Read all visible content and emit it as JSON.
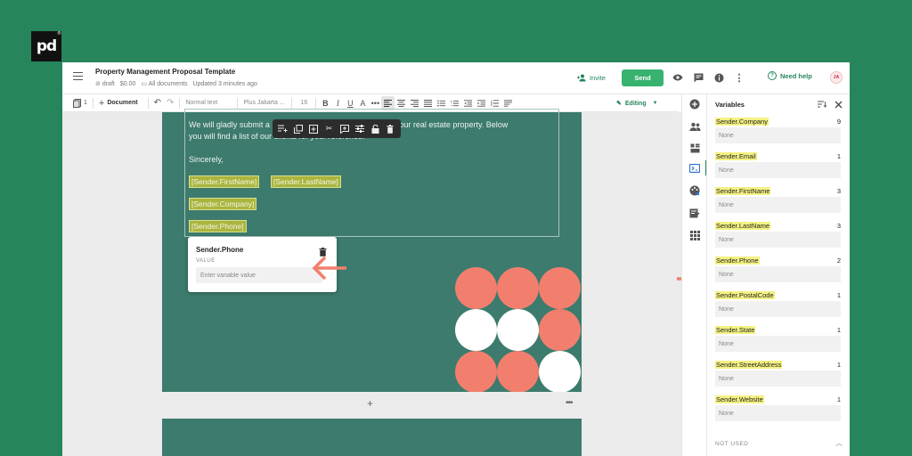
{
  "brand": {
    "logo_text": "pd",
    "logo_mark": "®"
  },
  "header": {
    "title": "Property Management Proposal Template",
    "status": "draft",
    "price": "$0.00",
    "folder": "All documents",
    "updated": "Updated 3 minutes ago",
    "invite_label": "Invite",
    "send_label": "Send",
    "help_label": "Need help",
    "avatar_initials": "JA"
  },
  "toolbar": {
    "page_count": "1",
    "document_label": "Document",
    "style_value": "Normal text",
    "font_value": "Plus Jakarta ...",
    "size_value": "16",
    "mode_label": "Editing"
  },
  "document": {
    "paragraph": "We will gladly submit a proposal for the management of your real estate property. Below you will find a list of our clients for your reference.",
    "paragraph_visible_start": "We will gladly submit a",
    "paragraph_visible_end": "ent of your real estate property. Below",
    "paragraph_line2": "you will find a list of our clients for your reference.",
    "signoff": "Sincerely,",
    "tags": {
      "first_name": "[Sender.FirstName]",
      "last_name": "[Sender.LastName]",
      "company": "[Sender.Company]",
      "phone": "[Sender.Phone]"
    }
  },
  "variable_popup": {
    "title": "Sender.Phone",
    "value_label": "VALUE",
    "placeholder": "Enter variable value"
  },
  "variables_panel": {
    "title": "Variables",
    "items": [
      {
        "name": "Sender.Company",
        "count": "9",
        "value": "None"
      },
      {
        "name": "Sender.Email",
        "count": "1",
        "value": "None"
      },
      {
        "name": "Sender.FirstName",
        "count": "3",
        "value": "None"
      },
      {
        "name": "Sender.LastName",
        "count": "3",
        "value": "None"
      },
      {
        "name": "Sender.Phone",
        "count": "2",
        "value": "None"
      },
      {
        "name": "Sender.PostalCode",
        "count": "1",
        "value": "None"
      },
      {
        "name": "Sender.State",
        "count": "1",
        "value": "None"
      },
      {
        "name": "Sender.StreetAddress",
        "count": "1",
        "value": "None"
      },
      {
        "name": "Sender.Website",
        "count": "1",
        "value": "None"
      }
    ],
    "not_used_label": "NOT USED"
  },
  "colors": {
    "background": "#27855c",
    "page": "#3c7b6d",
    "accent_green": "#37b36f",
    "coral": "#f27f6e",
    "tag_fill": "#aab53e",
    "var_highlight": "#f4f182"
  },
  "icons": [
    "menu-icon",
    "tag-icon",
    "folder-icon",
    "add-person-icon",
    "eye-icon",
    "comment-icon",
    "info-icon",
    "more-vertical-icon",
    "help-icon",
    "pages-icon",
    "plus-icon",
    "undo-icon",
    "redo-icon",
    "bold-icon",
    "italic-icon",
    "underline-icon",
    "text-color-icon",
    "align-left-icon",
    "align-center-icon",
    "align-right-icon",
    "justify-icon",
    "bullet-list-icon",
    "numbered-list-icon",
    "indent-icon",
    "outdent-icon",
    "line-spacing-icon",
    "clear-format-icon",
    "pencil-icon",
    "insert-icon",
    "copy-icon",
    "duplicate-icon",
    "cut-icon",
    "add-field-icon",
    "settings-icon",
    "lock-icon",
    "trash-icon",
    "arrow-left-icon",
    "add-circle-icon",
    "contacts-icon",
    "blocks-icon",
    "variables-icon",
    "palette-icon",
    "pricing-icon",
    "apps-icon",
    "sort-icon",
    "close-icon",
    "chevron-up-icon",
    "chevron-down-icon"
  ]
}
